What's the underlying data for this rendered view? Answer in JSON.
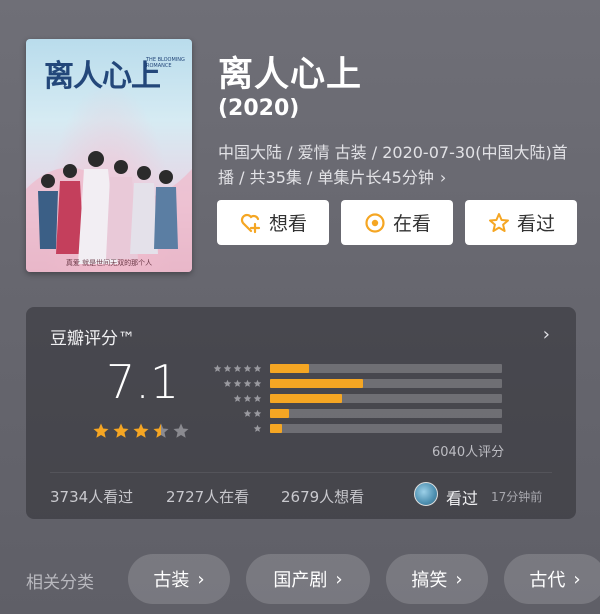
{
  "movie": {
    "title": "离人心上",
    "year": "(2020)",
    "meta": "中国大陆 / 爱情 古装 / 2020-07-30(中国大陆)首播 / 共35集 / 单集片长45分钟",
    "poster": {
      "title": "离人心上",
      "subtitle": "THE BLOOMING ROMANCE",
      "tagline": "真爱 就是世间无双的那个人"
    }
  },
  "actions": [
    {
      "label": "想看",
      "icon": "heart-plus-icon"
    },
    {
      "label": "在看",
      "icon": "target-icon"
    },
    {
      "label": "看过",
      "icon": "star-outline-icon"
    }
  ],
  "rating": {
    "title": "豆瓣评分™",
    "score": "7.1",
    "stars": 3.5,
    "distribution": [
      {
        "stars": 5,
        "fraction": 0.17
      },
      {
        "stars": 4,
        "fraction": 0.4
      },
      {
        "stars": 3,
        "fraction": 0.31
      },
      {
        "stars": 2,
        "fraction": 0.08
      },
      {
        "stars": 1,
        "fraction": 0.05
      }
    ],
    "count": "6040人评分",
    "watched": "3734人看过",
    "watching": "2727人在看",
    "want": "2679人想看",
    "my_status": "看过",
    "my_time": "17分钟前"
  },
  "colors": {
    "accent": "#f5a623",
    "empty_star": "#8a8a90"
  },
  "related": {
    "label": "相关分类",
    "chips": [
      "古装",
      "国产剧",
      "搞笑",
      "古代"
    ]
  }
}
